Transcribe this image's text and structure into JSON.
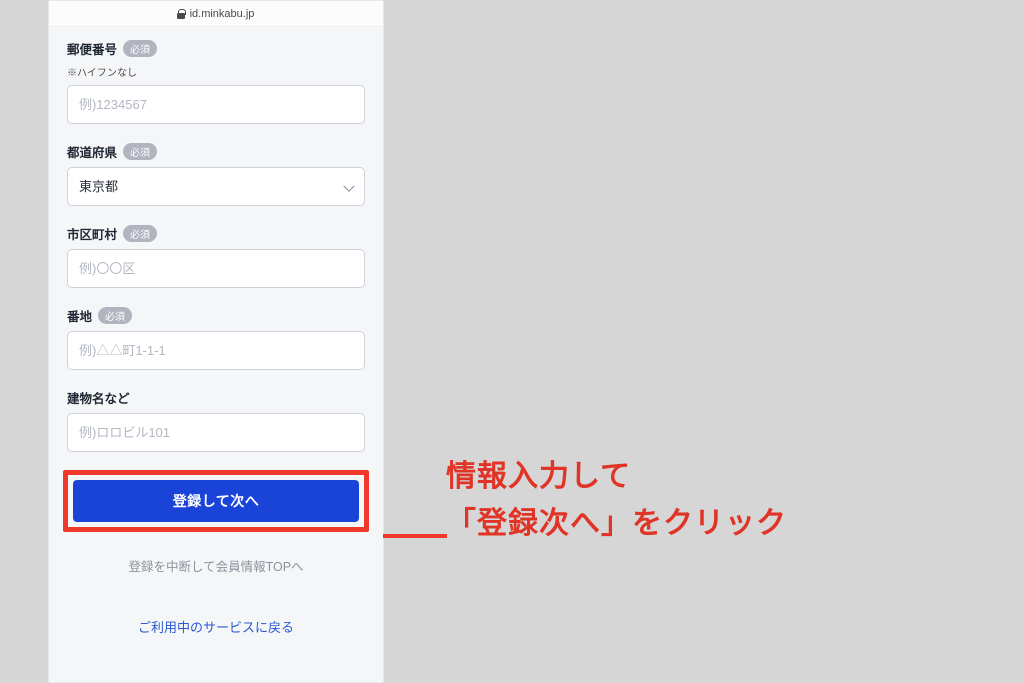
{
  "urlbar": {
    "domain": "id.minkabu.jp"
  },
  "badges": {
    "required": "必須"
  },
  "fields": {
    "postal": {
      "label": "郵便番号",
      "note": "※ハイフンなし",
      "placeholder": "例)1234567"
    },
    "prefecture": {
      "label": "都道府県",
      "value": "東京都"
    },
    "city": {
      "label": "市区町村",
      "placeholder": "例)〇〇区"
    },
    "street": {
      "label": "番地",
      "placeholder": "例)△△町1-1-1"
    },
    "building": {
      "label": "建物名など",
      "placeholder": "例)ロロビル101"
    }
  },
  "buttons": {
    "submit": "登録して次へ",
    "cancel": "登録を中断して会員情報TOPへ",
    "return": "ご利用中のサービスに戻る"
  },
  "annotation": {
    "line1": "情報入力して",
    "line2": "「登録次へ」をクリック"
  }
}
